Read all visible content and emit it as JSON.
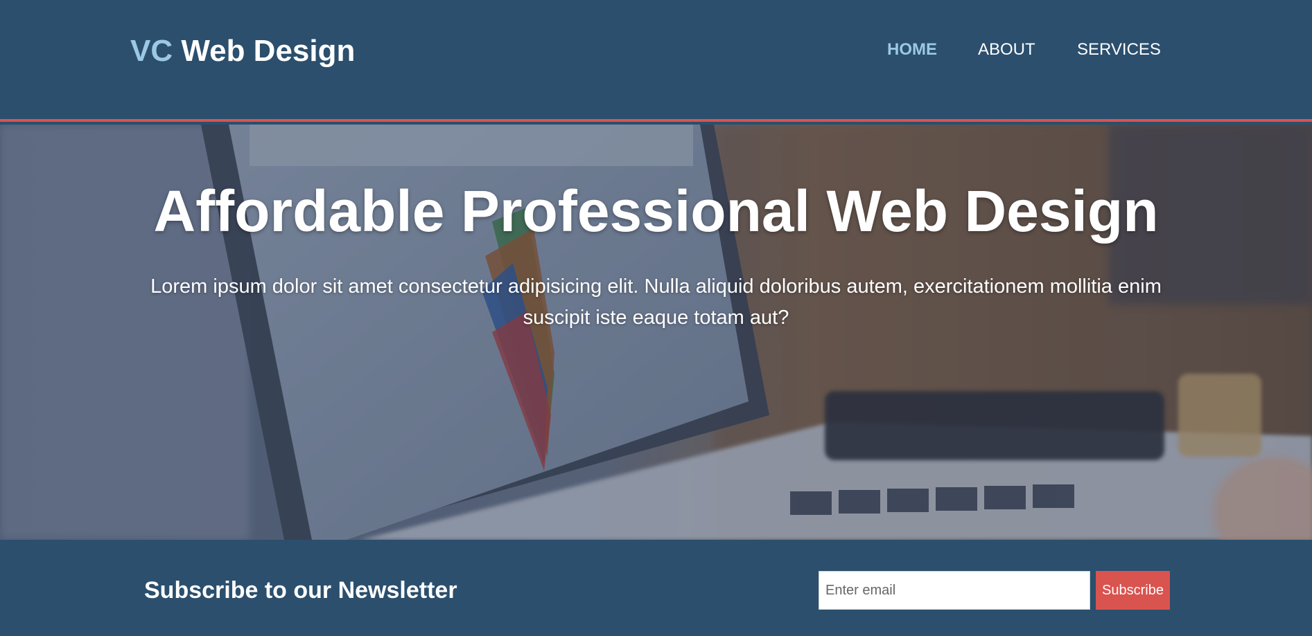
{
  "brand": {
    "accent_text": "VC",
    "main_text": "Web Design"
  },
  "nav": {
    "items": [
      {
        "label": "HOME",
        "active": true
      },
      {
        "label": "ABOUT",
        "active": false
      },
      {
        "label": "SERVICES",
        "active": false
      }
    ]
  },
  "hero": {
    "title": "Affordable Professional Web Design",
    "text": "Lorem ipsum dolor sit amet consectetur adipisicing elit. Nulla aliquid doloribus autem, exercitationem mollitia enim suscipit iste eaque totam aut?"
  },
  "newsletter": {
    "title": "Subscribe to our Newsletter",
    "email_placeholder": "Enter email",
    "email_value": "",
    "button_label": "Subscribe"
  },
  "colors": {
    "header_bg": "#2b4f6d",
    "accent_blue": "#9cc8e6",
    "accent_red": "#d9534f",
    "text_white": "#ffffff"
  },
  "icons": [
    "laptop-photo-background"
  ]
}
